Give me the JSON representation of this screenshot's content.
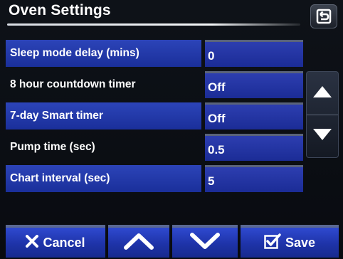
{
  "header": {
    "title": "Oven Settings",
    "back_icon": "return-arrow-icon"
  },
  "settings": [
    {
      "label": "Sleep mode delay (mins)",
      "value": "0",
      "highlighted": true
    },
    {
      "label": "8 hour countdown timer",
      "value": "Off",
      "highlighted": false
    },
    {
      "label": "7-day Smart timer",
      "value": "Off",
      "highlighted": true
    },
    {
      "label": "Pump time (sec)",
      "value": "0.5",
      "highlighted": false
    },
    {
      "label": "Chart interval (sec)",
      "value": "5",
      "highlighted": true
    }
  ],
  "scrollbar": {
    "up_icon": "triangle-up-icon",
    "down_icon": "triangle-down-icon"
  },
  "toolbar": {
    "cancel_label": "Cancel",
    "cancel_icon": "x-icon",
    "up_icon": "chevron-up-icon",
    "down_icon": "chevron-down-icon",
    "save_label": "Save",
    "save_icon": "checkbox-check-icon"
  },
  "colors": {
    "row_highlight": "#2233b0",
    "value_cell": "#2436a4",
    "background": "#0a0d12"
  }
}
